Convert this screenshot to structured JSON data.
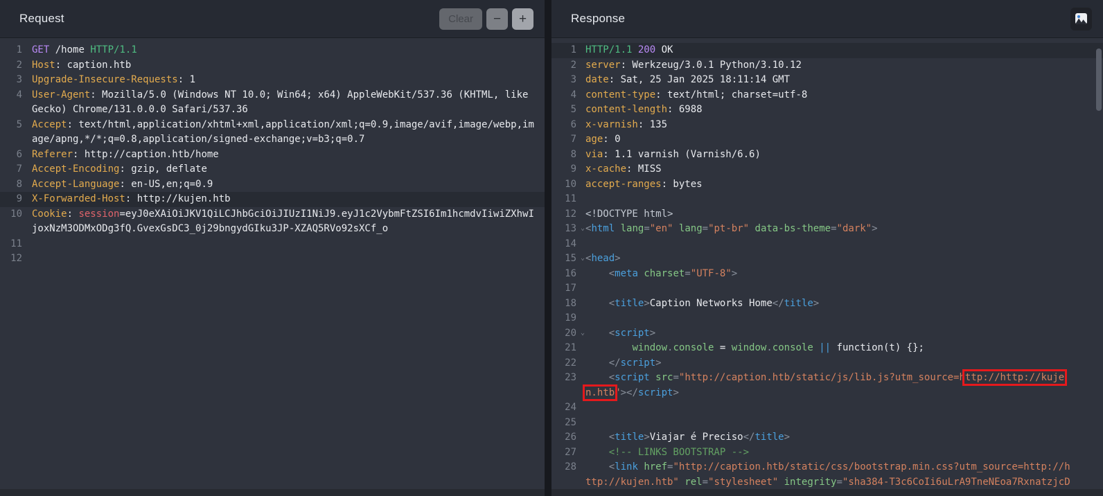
{
  "colors": {
    "annotation_red": "#e5191c",
    "editor_bg": "#2f333d",
    "header_bg": "#262a33",
    "syntax_header_name": "#e3ab4e",
    "syntax_string": "#d5825f",
    "syntax_tag": "#4ba0dd",
    "syntax_method": "#b98af5",
    "syntax_version": "#4fbd82"
  },
  "editor": {
    "fold_icon": "⌄"
  },
  "request": {
    "title": "Request",
    "buttons": {
      "clear": "Clear",
      "decrease": "−",
      "increase": "+"
    },
    "rows": [
      {
        "num": "1",
        "seg": [
          [
            "method",
            "GET"
          ],
          [
            "plain",
            " /home "
          ],
          [
            "version",
            "HTTP/1.1"
          ]
        ]
      },
      {
        "num": "2",
        "seg": [
          [
            "hname",
            "Host"
          ],
          [
            "plain",
            ": caption.htb"
          ]
        ]
      },
      {
        "num": "3",
        "seg": [
          [
            "hname",
            "Upgrade-Insecure-Requests"
          ],
          [
            "plain",
            ": 1"
          ]
        ]
      },
      {
        "num": "4",
        "seg": [
          [
            "hname",
            "User-Agent"
          ],
          [
            "plain",
            ": Mozilla/5.0 (Windows NT 10.0; Win64; x64) AppleWebKit/537.36 (KHTML, like"
          ]
        ]
      },
      {
        "num": "",
        "seg": [
          [
            "plain",
            "Gecko) Chrome/131.0.0.0 Safari/537.36"
          ]
        ]
      },
      {
        "num": "5",
        "seg": [
          [
            "hname",
            "Accept"
          ],
          [
            "plain",
            ": text/html,application/xhtml+xml,application/xml;q=0.9,image/avif,image/webp,im"
          ]
        ]
      },
      {
        "num": "",
        "seg": [
          [
            "plain",
            "age/apng,*/*;q=0.8,application/signed-exchange;v=b3;q=0.7"
          ]
        ]
      },
      {
        "num": "6",
        "seg": [
          [
            "hname",
            "Referer"
          ],
          [
            "plain",
            ": http://caption.htb/home"
          ]
        ]
      },
      {
        "num": "7",
        "seg": [
          [
            "hname",
            "Accept-Encoding"
          ],
          [
            "plain",
            ": gzip, deflate"
          ]
        ]
      },
      {
        "num": "8",
        "seg": [
          [
            "hname",
            "Accept-Language"
          ],
          [
            "plain",
            ": en-US,en;q=0.9"
          ]
        ]
      },
      {
        "num": "9",
        "hl": true,
        "seg": [
          [
            "hname",
            "X-Forwarded-Host"
          ],
          [
            "plain",
            ": http://kujen.htb"
          ]
        ]
      },
      {
        "num": "10",
        "seg": [
          [
            "hname",
            "Cookie"
          ],
          [
            "plain",
            ": "
          ],
          [
            "param",
            "session"
          ],
          [
            "plain",
            "=eyJ0eXAiOiJKV1QiLCJhbGciOiJIUzI1NiJ9.eyJ1c2VybmFtZSI6Im1hcmdvIiwiZXhwI"
          ]
        ]
      },
      {
        "num": "",
        "seg": [
          [
            "plain",
            "joxNzM3ODMxODg3fQ.GvexGsDC3_0j29bngydGIku3JP-XZAQ5RVo92sXCf_o"
          ]
        ]
      },
      {
        "num": "11",
        "seg": []
      },
      {
        "num": "12",
        "seg": []
      }
    ]
  },
  "response": {
    "title": "Response",
    "rows": [
      {
        "num": "1",
        "hl": true,
        "seg": [
          [
            "version",
            "HTTP/1.1"
          ],
          [
            "plain",
            " "
          ],
          [
            "status",
            "200"
          ],
          [
            "plain",
            " OK"
          ]
        ]
      },
      {
        "num": "2",
        "seg": [
          [
            "hname",
            "server"
          ],
          [
            "plain",
            ": Werkzeug/3.0.1 Python/3.10.12"
          ]
        ]
      },
      {
        "num": "3",
        "seg": [
          [
            "hname",
            "date"
          ],
          [
            "plain",
            ": Sat, 25 Jan 2025 18:11:14 GMT"
          ]
        ]
      },
      {
        "num": "4",
        "seg": [
          [
            "hname",
            "content-type"
          ],
          [
            "plain",
            ": text/html; charset=utf-8"
          ]
        ]
      },
      {
        "num": "5",
        "seg": [
          [
            "hname",
            "content-length"
          ],
          [
            "plain",
            ": 6988"
          ]
        ]
      },
      {
        "num": "6",
        "seg": [
          [
            "hname",
            "x-varnish"
          ],
          [
            "plain",
            ": 135"
          ]
        ]
      },
      {
        "num": "7",
        "seg": [
          [
            "hname",
            "age"
          ],
          [
            "plain",
            ": 0"
          ]
        ]
      },
      {
        "num": "8",
        "seg": [
          [
            "hname",
            "via"
          ],
          [
            "plain",
            ": 1.1 varnish (Varnish/6.6)"
          ]
        ]
      },
      {
        "num": "9",
        "seg": [
          [
            "hname",
            "x-cache"
          ],
          [
            "plain",
            ": MISS"
          ]
        ]
      },
      {
        "num": "10",
        "seg": [
          [
            "hname",
            "accept-ranges"
          ],
          [
            "plain",
            ": bytes"
          ]
        ]
      },
      {
        "num": "11",
        "seg": []
      },
      {
        "num": "12",
        "seg": [
          [
            "doctype",
            "<!DOCTYPE html>"
          ]
        ]
      },
      {
        "num": "13",
        "fold": true,
        "seg": [
          [
            "punc",
            "<"
          ],
          [
            "tag",
            "html"
          ],
          [
            "plain",
            " "
          ],
          [
            "attr",
            "lang"
          ],
          [
            "punc",
            "="
          ],
          [
            "str",
            "\"en\""
          ],
          [
            "plain",
            " "
          ],
          [
            "attr",
            "lang"
          ],
          [
            "punc",
            "="
          ],
          [
            "str",
            "\"pt-br\""
          ],
          [
            "plain",
            " "
          ],
          [
            "attr",
            "data-bs-theme"
          ],
          [
            "punc",
            "="
          ],
          [
            "str",
            "\"dark\""
          ],
          [
            "punc",
            ">"
          ]
        ]
      },
      {
        "num": "14",
        "seg": []
      },
      {
        "num": "15",
        "fold": true,
        "seg": [
          [
            "punc",
            "<"
          ],
          [
            "tag",
            "head"
          ],
          [
            "punc",
            ">"
          ]
        ]
      },
      {
        "num": "16",
        "seg": [
          [
            "plain",
            "    "
          ],
          [
            "punc",
            "<"
          ],
          [
            "tag",
            "meta"
          ],
          [
            "plain",
            " "
          ],
          [
            "attr",
            "charset"
          ],
          [
            "punc",
            "="
          ],
          [
            "str",
            "\"UTF-8\""
          ],
          [
            "punc",
            ">"
          ]
        ]
      },
      {
        "num": "17",
        "seg": []
      },
      {
        "num": "18",
        "seg": [
          [
            "plain",
            "    "
          ],
          [
            "punc",
            "<"
          ],
          [
            "tag",
            "title"
          ],
          [
            "punc",
            ">"
          ],
          [
            "plain",
            "Caption Networks Home"
          ],
          [
            "punc",
            "</"
          ],
          [
            "tag",
            "title"
          ],
          [
            "punc",
            ">"
          ]
        ]
      },
      {
        "num": "19",
        "seg": []
      },
      {
        "num": "20",
        "fold": true,
        "seg": [
          [
            "plain",
            "    "
          ],
          [
            "punc",
            "<"
          ],
          [
            "tag",
            "script"
          ],
          [
            "punc",
            ">"
          ]
        ]
      },
      {
        "num": "21",
        "seg": [
          [
            "plain",
            "        "
          ],
          [
            "attr",
            "window"
          ],
          [
            "punc",
            "."
          ],
          [
            "attr",
            "console"
          ],
          [
            "plain",
            " = "
          ],
          [
            "attr",
            "window"
          ],
          [
            "punc",
            "."
          ],
          [
            "attr",
            "console"
          ],
          [
            "plain",
            " "
          ],
          [
            "op",
            "||"
          ],
          [
            "plain",
            " function("
          ],
          [
            "plain",
            "t"
          ],
          [
            "plain",
            ") {};"
          ]
        ]
      },
      {
        "num": "22",
        "seg": [
          [
            "plain",
            "    "
          ],
          [
            "punc",
            "</"
          ],
          [
            "tag",
            "script"
          ],
          [
            "punc",
            ">"
          ]
        ]
      },
      {
        "num": "23",
        "seg": [
          [
            "plain",
            "    "
          ],
          [
            "punc",
            "<"
          ],
          [
            "tag",
            "script"
          ],
          [
            "plain",
            " "
          ],
          [
            "attr",
            "src"
          ],
          [
            "punc",
            "="
          ],
          [
            "str",
            "\"http://caption.htb/static/js/lib.js?utm_source=h"
          ],
          [
            "str",
            "ttp://http://kuje",
            "box"
          ]
        ]
      },
      {
        "num": "",
        "seg": [
          [
            "str",
            "n.htb",
            "box"
          ],
          [
            "str",
            "\""
          ],
          [
            "punc",
            ">"
          ],
          [
            "punc",
            "</"
          ],
          [
            "tag",
            "script"
          ],
          [
            "punc",
            ">"
          ]
        ]
      },
      {
        "num": "24",
        "seg": []
      },
      {
        "num": "25",
        "seg": []
      },
      {
        "num": "26",
        "seg": [
          [
            "plain",
            "    "
          ],
          [
            "punc",
            "<"
          ],
          [
            "tag",
            "title"
          ],
          [
            "punc",
            ">"
          ],
          [
            "plain",
            "Viajar é Preciso"
          ],
          [
            "punc",
            "</"
          ],
          [
            "tag",
            "title"
          ],
          [
            "punc",
            ">"
          ]
        ]
      },
      {
        "num": "27",
        "seg": [
          [
            "plain",
            "    "
          ],
          [
            "comment",
            "<!-- LINKS BOOTSTRAP -->"
          ]
        ]
      },
      {
        "num": "28",
        "seg": [
          [
            "plain",
            "    "
          ],
          [
            "punc",
            "<"
          ],
          [
            "tag",
            "link"
          ],
          [
            "plain",
            " "
          ],
          [
            "attr",
            "href"
          ],
          [
            "punc",
            "="
          ],
          [
            "str",
            "\"http://caption.htb/static/css/bootstrap.min.css?utm_source=http://h"
          ]
        ]
      },
      {
        "num": "",
        "seg": [
          [
            "str",
            "ttp://kujen.htb\""
          ],
          [
            "plain",
            " "
          ],
          [
            "attr",
            "rel"
          ],
          [
            "punc",
            "="
          ],
          [
            "str",
            "\"stylesheet\""
          ],
          [
            "plain",
            " "
          ],
          [
            "attr",
            "integrity"
          ],
          [
            "punc",
            "="
          ],
          [
            "str",
            "\"sha384-T3c6CoIi6uLrA9TneNEoa7RxnatzjcD"
          ]
        ]
      }
    ]
  }
}
